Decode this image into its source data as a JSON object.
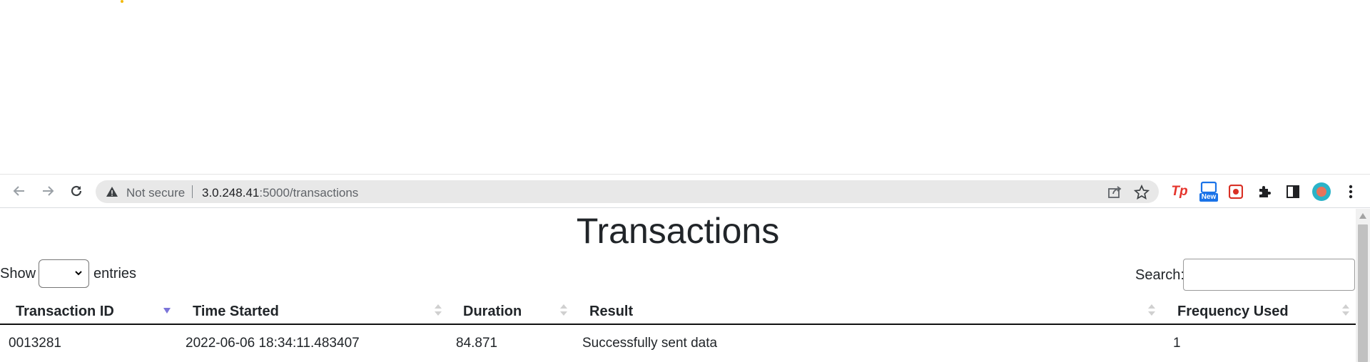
{
  "browser": {
    "security_label": "Not secure",
    "url_host": "3.0.248.41",
    "url_rest": ":5000/transactions",
    "extensions": [
      {
        "name": "Tp",
        "color": "#e5342c"
      },
      {
        "name": "New",
        "color": "#1a73e8"
      }
    ]
  },
  "page": {
    "title": "Transactions",
    "show_label": "Show",
    "entries_label": "entries",
    "length_value": "",
    "search_label": "Search:",
    "search_value": ""
  },
  "table": {
    "columns": [
      "Transaction ID",
      "Time Started",
      "Duration",
      "Result",
      "Frequency Used"
    ],
    "sort_color": "#7b74d9",
    "rows": [
      [
        "0013281",
        "2022-06-06 18:34:11.483407",
        "84.871",
        "Successfully sent data",
        "1"
      ]
    ]
  }
}
